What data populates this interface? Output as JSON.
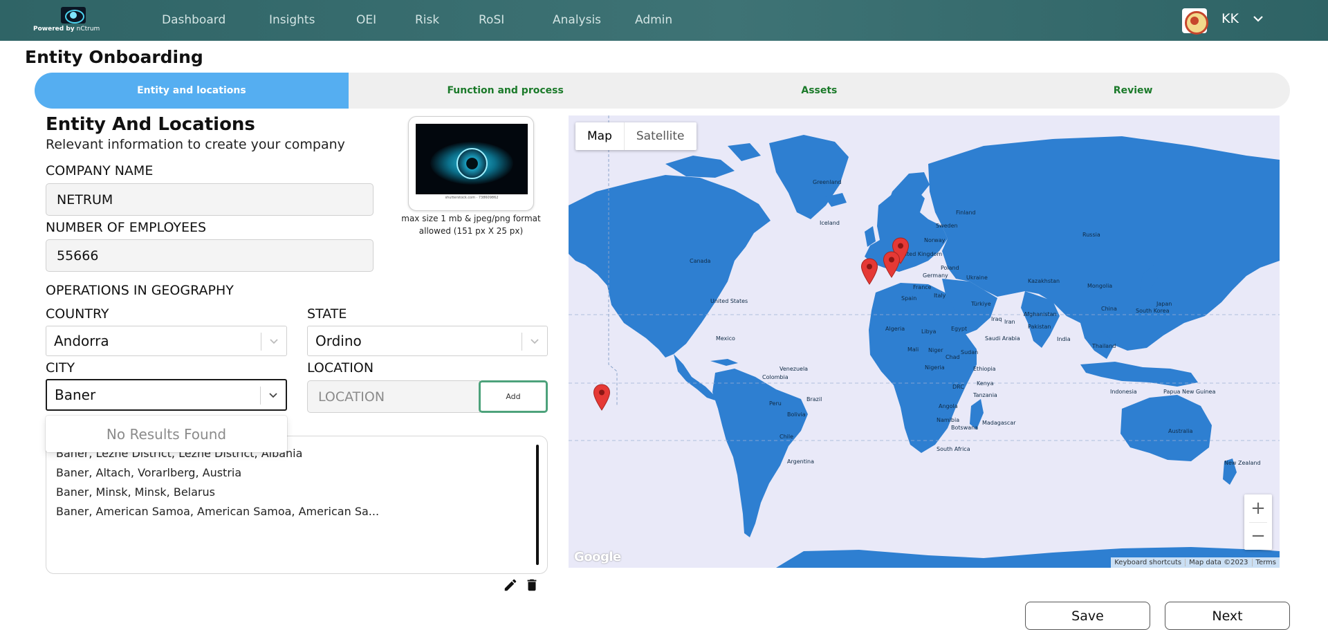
{
  "brand": {
    "powered_by": "Powered by",
    "company": "nCtrum"
  },
  "nav": {
    "items": [
      "Dashboard",
      "Insights",
      "OEI",
      "Risk",
      "RoSI",
      "Analysis",
      "Admin"
    ]
  },
  "user": {
    "initials": "KK"
  },
  "page": {
    "title": "Entity Onboarding"
  },
  "stepper": {
    "steps": [
      "Entity and locations",
      "Function and process",
      "Assets",
      "Review"
    ],
    "active_step": "Entity and locations"
  },
  "form": {
    "title": "Entity And Locations",
    "subtitle": "Relevant information to create your company",
    "company_name_label": "COMPANY NAME",
    "company_name_value": "NETRUM",
    "employees_label": "NUMBER OF EMPLOYEES",
    "employees_value": "55666",
    "geography_label": "OPERATIONS IN GEOGRAPHY",
    "country_label": "COUNTRY",
    "country_value": "Andorra",
    "state_label": "STATE",
    "state_value": "Ordino",
    "city_label": "CITY",
    "city_value": "Baner",
    "location_label": "LOCATION",
    "location_placeholder": "LOCATION",
    "add_label": "Add",
    "city_dropdown_message": "No Results Found",
    "logo_credit": "shutterstock.com · 738609862",
    "logo_note": "max size 1 mb & jpeg/png format allowed (151 px X 25 px)"
  },
  "locations": [
    "Baner, Lezhe District, Lezhe District, Albania",
    "Baner, Altach, Vorarlberg, Austria",
    "Baner, Minsk, Minsk, Belarus",
    "Baner, American Samoa, American Samoa, American Sa..."
  ],
  "map": {
    "type_options": [
      "Map",
      "Satellite"
    ],
    "selected_type": "Map",
    "zoom_in": "+",
    "zoom_out": "−",
    "google": "Google",
    "attribution": [
      "Keyboard shortcuts",
      "Map data ©2023",
      "Terms"
    ],
    "labels": [
      "Greenland",
      "Iceland",
      "Finland",
      "Sweden",
      "Norway",
      "United Kingdom",
      "Germany",
      "Poland",
      "Ukraine",
      "France",
      "Spain",
      "Italy",
      "Türkiye",
      "Russia",
      "Kazakhstan",
      "Mongolia",
      "China",
      "South Korea",
      "Japan",
      "Canada",
      "United States",
      "Mexico",
      "Venezuela",
      "Colombia",
      "Peru",
      "Brazil",
      "Bolivia",
      "Chile",
      "Argentina",
      "Algeria",
      "Libya",
      "Egypt",
      "Mali",
      "Niger",
      "Chad",
      "Sudan",
      "Nigeria",
      "Ethiopia",
      "DRC",
      "Kenya",
      "Tanzania",
      "Angola",
      "Namibia",
      "Botswana",
      "South Africa",
      "Madagascar",
      "Iraq",
      "Iran",
      "Afghanistan",
      "Pakistan",
      "Saudi Arabia",
      "India",
      "Thailand",
      "Indonesia",
      "Papua New Guinea",
      "Australia",
      "New Zealand"
    ],
    "accent": "#2e7fd1"
  },
  "actions": {
    "save": "Save",
    "next": "Next"
  }
}
